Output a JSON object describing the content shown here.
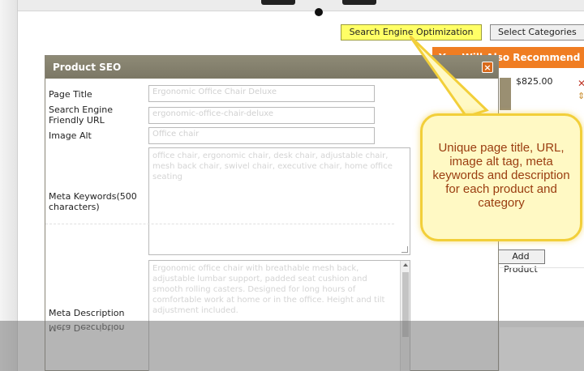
{
  "toolbar": {
    "seo_button_label": "Search Engine Optimization",
    "categories_button_label": "Select Categories"
  },
  "background": {
    "recommend_label": "You Will Also Recommend",
    "price": "$825.00",
    "add_product_label": "Add Product"
  },
  "modal": {
    "title": "Product SEO",
    "close_glyph": "×",
    "fields": {
      "page_title": {
        "label": "Page Title",
        "value": "Ergonomic Office Chair Deluxe"
      },
      "seo_url": {
        "label": "Search Engine Friendly URL",
        "value": "ergonomic-office-chair-deluxe"
      },
      "image_alt": {
        "label": "Image Alt",
        "value": "Office chair"
      },
      "meta_keywords": {
        "label": "Meta Keywords(500 characters)",
        "value": "office chair, ergonomic chair, desk chair, adjustable chair, mesh back chair, swivel chair, executive chair, home office seating"
      },
      "meta_description": {
        "label": "Meta Description",
        "value": "Ergonomic office chair with breathable mesh back, adjustable lumbar support, padded seat cushion and smooth rolling casters. Designed for long hours of comfortable work at home or in the office. Height and tilt adjustment included."
      }
    }
  },
  "callout": {
    "text": "Unique page title, URL, image alt tag, meta keywords and description for each product and category"
  },
  "reflection": {
    "text": "Meta Description"
  },
  "colors": {
    "seo_highlight": "#ffff66",
    "modal_header": "#7b7765",
    "accent_orange": "#f07d22",
    "callout_fill": "#fff9c4",
    "callout_border": "#f2cf3a",
    "callout_text": "#9a3d10"
  }
}
